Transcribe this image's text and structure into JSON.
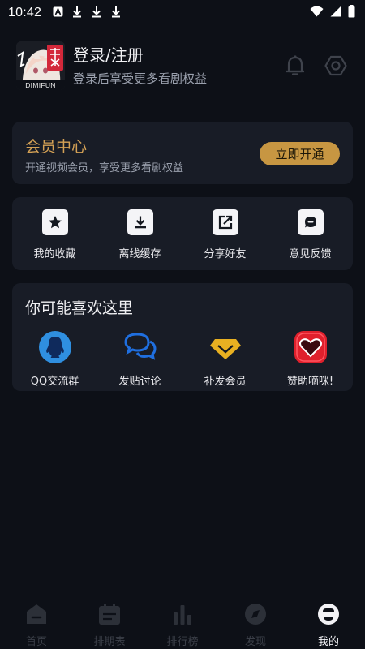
{
  "status_bar": {
    "time": "10:42",
    "notification_icons": [
      "a-box-icon",
      "download-icon",
      "download-icon",
      "download-icon"
    ],
    "right_icons": [
      "wifi-icon",
      "signal-icon",
      "battery-icon"
    ]
  },
  "profile": {
    "avatar_caption": "DIMIFUN",
    "title": "登录/注册",
    "subtitle": "登录后享受更多看剧权益",
    "actions": [
      "bell-icon",
      "settings-hexagon-icon"
    ]
  },
  "vip": {
    "title": "会员中心",
    "subtitle": "开通视频会员，享受更多看剧权益",
    "button": "立即开通",
    "accent": "#d4a155",
    "button_color": "#c79642"
  },
  "tools": [
    {
      "label": "我的收藏",
      "icon": "star-icon"
    },
    {
      "label": "离线缓存",
      "icon": "download-icon"
    },
    {
      "label": "分享好友",
      "icon": "share-icon"
    },
    {
      "label": "意见反馈",
      "icon": "feedback-icon"
    }
  ],
  "likes": {
    "title": "你可能喜欢这里",
    "items": [
      {
        "label": "QQ交流群",
        "icon": "qq-icon",
        "color": "#2f8fe0"
      },
      {
        "label": "发贴讨论",
        "icon": "chat-bubbles-icon",
        "color": "#1f6fe0"
      },
      {
        "label": "补发会员",
        "icon": "diamond-icon",
        "color": "#e8b021"
      },
      {
        "label": "赞助嘀咪!",
        "icon": "heart-icon",
        "color": "#e0202c"
      }
    ]
  },
  "bottom_nav": {
    "items": [
      {
        "label": "首页",
        "icon": "home-icon",
        "active": false
      },
      {
        "label": "排期表",
        "icon": "calendar-icon",
        "active": false
      },
      {
        "label": "排行榜",
        "icon": "bar-chart-icon",
        "active": false
      },
      {
        "label": "发现",
        "icon": "compass-icon",
        "active": false
      },
      {
        "label": "我的",
        "icon": "profile-icon",
        "active": true
      }
    ]
  }
}
